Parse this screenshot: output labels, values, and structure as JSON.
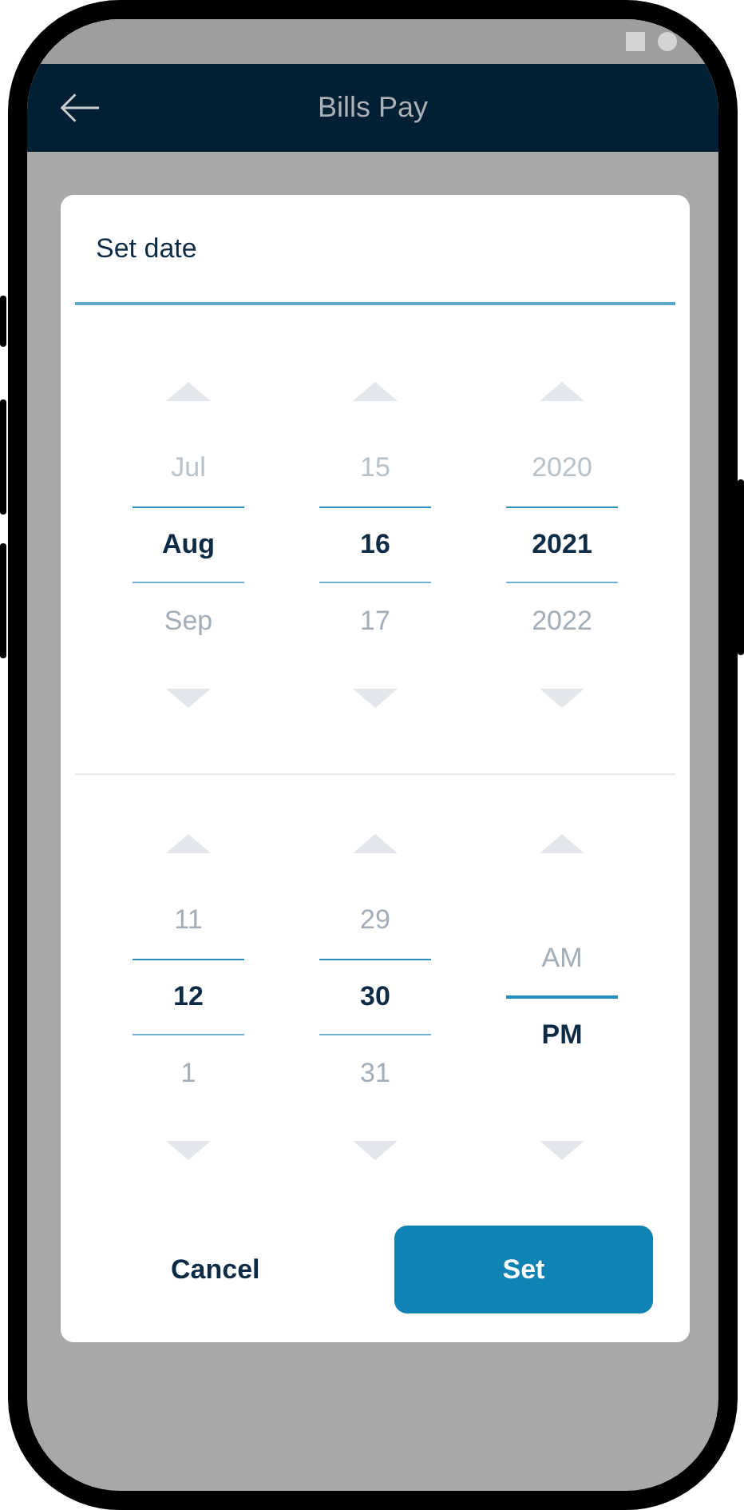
{
  "app_bar": {
    "title": "Bills Pay"
  },
  "dialog": {
    "title": "Set date",
    "date_columns": [
      {
        "kind": "wheel",
        "items": [
          {
            "text": "Jul",
            "selected": false,
            "dimmed": true
          },
          {
            "text": "Aug",
            "selected": true,
            "dimmed": false
          },
          {
            "text": "Sep",
            "selected": false,
            "dimmed": false
          }
        ]
      },
      {
        "kind": "wheel",
        "items": [
          {
            "text": "15",
            "selected": false,
            "dimmed": true
          },
          {
            "text": "16",
            "selected": true,
            "dimmed": false
          },
          {
            "text": "17",
            "selected": false,
            "dimmed": false
          }
        ]
      },
      {
        "kind": "wheel",
        "items": [
          {
            "text": "2020",
            "selected": false,
            "dimmed": true
          },
          {
            "text": "2021",
            "selected": true,
            "dimmed": false
          },
          {
            "text": "2022",
            "selected": false,
            "dimmed": false
          }
        ]
      }
    ],
    "time_columns": [
      {
        "kind": "wheel",
        "items": [
          {
            "text": "11",
            "selected": false,
            "dimmed": false
          },
          {
            "text": "12",
            "selected": true,
            "dimmed": false
          },
          {
            "text": "1",
            "selected": false,
            "dimmed": false
          }
        ]
      },
      {
        "kind": "wheel",
        "items": [
          {
            "text": "29",
            "selected": false,
            "dimmed": false
          },
          {
            "text": "30",
            "selected": true,
            "dimmed": false
          },
          {
            "text": "31",
            "selected": false,
            "dimmed": false
          }
        ]
      },
      {
        "kind": "toggle",
        "items": [
          {
            "text": "AM",
            "selected": false,
            "dimmed": false
          },
          {
            "text": "PM",
            "selected": true,
            "dimmed": false
          }
        ]
      }
    ],
    "buttons": [
      {
        "label": "Cancel",
        "kind": "text"
      },
      {
        "label": "Set",
        "kind": "primary"
      }
    ]
  }
}
